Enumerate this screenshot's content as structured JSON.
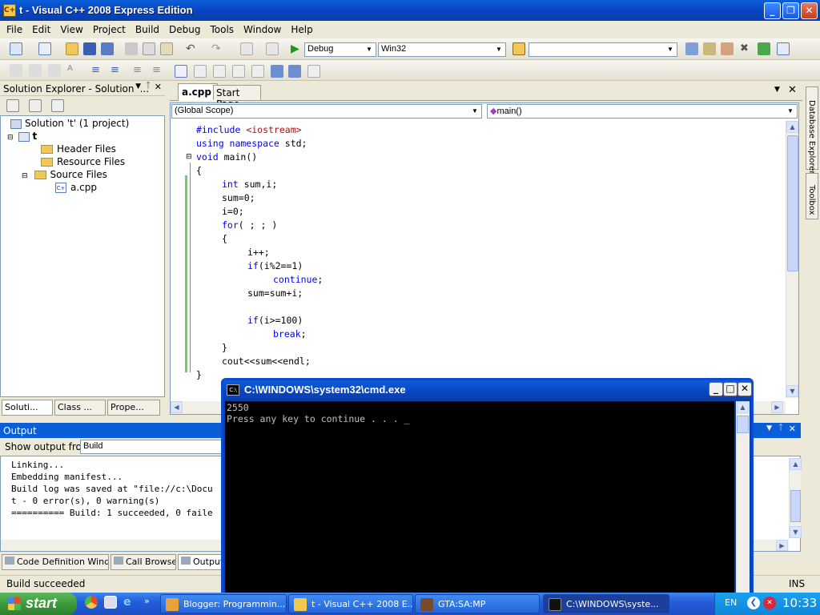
{
  "window": {
    "title": "t - Visual C++ 2008 Express Edition",
    "minimize": "_",
    "maximize": "❐",
    "close": "✕"
  },
  "menu": [
    "File",
    "Edit",
    "View",
    "Project",
    "Build",
    "Debug",
    "Tools",
    "Window",
    "Help"
  ],
  "toolbar": {
    "config": "Debug",
    "platform": "Win32",
    "find": ""
  },
  "solution_explorer": {
    "title": "Solution Explorer - Solution '...",
    "pin": "📌",
    "close": "✕",
    "items": [
      {
        "label": "Solution 't' (1 project)"
      },
      {
        "label": "t"
      },
      {
        "label": "Header Files"
      },
      {
        "label": "Resource Files"
      },
      {
        "label": "Source Files"
      },
      {
        "label": "a.cpp"
      }
    ],
    "tabs": [
      "Soluti...",
      "Class ...",
      "Prope..."
    ]
  },
  "editor": {
    "tabs": [
      "a.cpp",
      "Start Page"
    ],
    "scope": "(Global Scope)",
    "member": "main()",
    "side_labels": [
      "Database Explorer",
      "Toolbox"
    ],
    "code": [
      {
        "indent": 0,
        "parts": [
          {
            "t": "#include ",
            "c": "kw"
          },
          {
            "t": "<iostream>",
            "c": "str"
          }
        ]
      },
      {
        "indent": 0,
        "parts": [
          {
            "t": "using namespace",
            "c": "kw"
          },
          {
            "t": " std;",
            "c": ""
          }
        ]
      },
      {
        "indent": 0,
        "parts": [
          {
            "t": "void",
            "c": "kw"
          },
          {
            "t": " main()",
            "c": ""
          }
        ]
      },
      {
        "indent": 0,
        "parts": [
          {
            "t": "{",
            "c": ""
          }
        ]
      },
      {
        "indent": 1,
        "parts": [
          {
            "t": "int",
            "c": "kw"
          },
          {
            "t": " sum,i;",
            "c": ""
          }
        ]
      },
      {
        "indent": 1,
        "parts": [
          {
            "t": "sum=0;",
            "c": ""
          }
        ]
      },
      {
        "indent": 1,
        "parts": [
          {
            "t": "i=0;",
            "c": ""
          }
        ]
      },
      {
        "indent": 1,
        "parts": [
          {
            "t": "for",
            "c": "kw"
          },
          {
            "t": "( ; ; )",
            "c": ""
          }
        ]
      },
      {
        "indent": 1,
        "parts": [
          {
            "t": "{",
            "c": ""
          }
        ]
      },
      {
        "indent": 2,
        "parts": [
          {
            "t": "i++;",
            "c": ""
          }
        ]
      },
      {
        "indent": 2,
        "parts": [
          {
            "t": "if",
            "c": "kw"
          },
          {
            "t": "(i%2==1)",
            "c": ""
          }
        ]
      },
      {
        "indent": 3,
        "parts": [
          {
            "t": "continue",
            "c": "kw"
          },
          {
            "t": ";",
            "c": ""
          }
        ]
      },
      {
        "indent": 2,
        "parts": [
          {
            "t": "sum=sum+i;",
            "c": ""
          }
        ]
      },
      {
        "indent": 0,
        "parts": []
      },
      {
        "indent": 2,
        "parts": [
          {
            "t": "if",
            "c": "kw"
          },
          {
            "t": "(i>=100)",
            "c": ""
          }
        ]
      },
      {
        "indent": 3,
        "parts": [
          {
            "t": "break",
            "c": "kw"
          },
          {
            "t": ";",
            "c": ""
          }
        ]
      },
      {
        "indent": 1,
        "parts": [
          {
            "t": "}",
            "c": ""
          }
        ]
      },
      {
        "indent": 1,
        "parts": [
          {
            "t": "cout<<sum<<endl;",
            "c": ""
          }
        ]
      },
      {
        "indent": 0,
        "parts": [
          {
            "t": "}",
            "c": ""
          }
        ]
      }
    ]
  },
  "output": {
    "title": "Output",
    "show_label": "Show output from:",
    "show_value": "Build",
    "lines": [
      "Linking...",
      "Embedding manifest...",
      "Build log was saved at \"file://c:\\Docu",
      "t - 0 error(s), 0 warning(s)",
      "========== Build: 1 succeeded, 0 faile"
    ],
    "bottom_tabs": [
      "Code Definition Window",
      "Call Browser",
      "Output"
    ]
  },
  "cmd": {
    "title": "C:\\WINDOWS\\system32\\cmd.exe",
    "lines": [
      "2550",
      "Press any key to continue . . . _"
    ]
  },
  "status": {
    "text": "Build succeeded",
    "mode": "INS"
  },
  "taskbar": {
    "start": "start",
    "items": [
      {
        "label": "Blogger: Programmin...",
        "color": "#e8a23c"
      },
      {
        "label": "t - Visual C++ 2008 E...",
        "color": "#f2c94c"
      },
      {
        "label": "GTA:SA:MP",
        "color": "#7a4b2a"
      },
      {
        "label": "C:\\WINDOWS\\syste...",
        "color": "#111111"
      }
    ],
    "lang": "EN",
    "clock": "10:33"
  }
}
